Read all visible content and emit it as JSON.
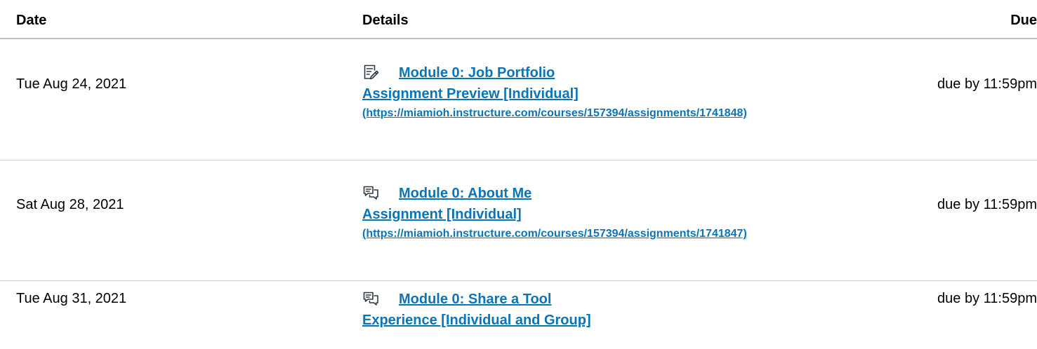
{
  "table": {
    "headers": {
      "date": "Date",
      "details": "Details",
      "due": "Due"
    },
    "rows": [
      {
        "date": "Tue Aug 24, 2021",
        "icon": "assignment-icon",
        "title_line1": "Module 0: Job Portfolio",
        "title_line2": "Assignment Preview [Individual]",
        "url": "(https://miamioh.instructure.com/courses/157394/assignments/1741848)",
        "due": "due by 11:59pm"
      },
      {
        "date": "Sat Aug 28, 2021",
        "icon": "discussion-icon",
        "title_line1": "Module 0: About Me",
        "title_line2": "Assignment [Individual]",
        "url": "(https://miamioh.instructure.com/courses/157394/assignments/1741847)",
        "due": "due by 11:59pm"
      },
      {
        "date": "Tue Aug 31, 2021",
        "icon": "discussion-icon",
        "title_line1": "Module 0: Share a Tool",
        "title_line2": "Experience [Individual and Group]",
        "due": "due by 11:59pm"
      }
    ]
  },
  "colors": {
    "link": "#0a74b9",
    "text": "#000000",
    "divider": "#c7cdd1"
  }
}
